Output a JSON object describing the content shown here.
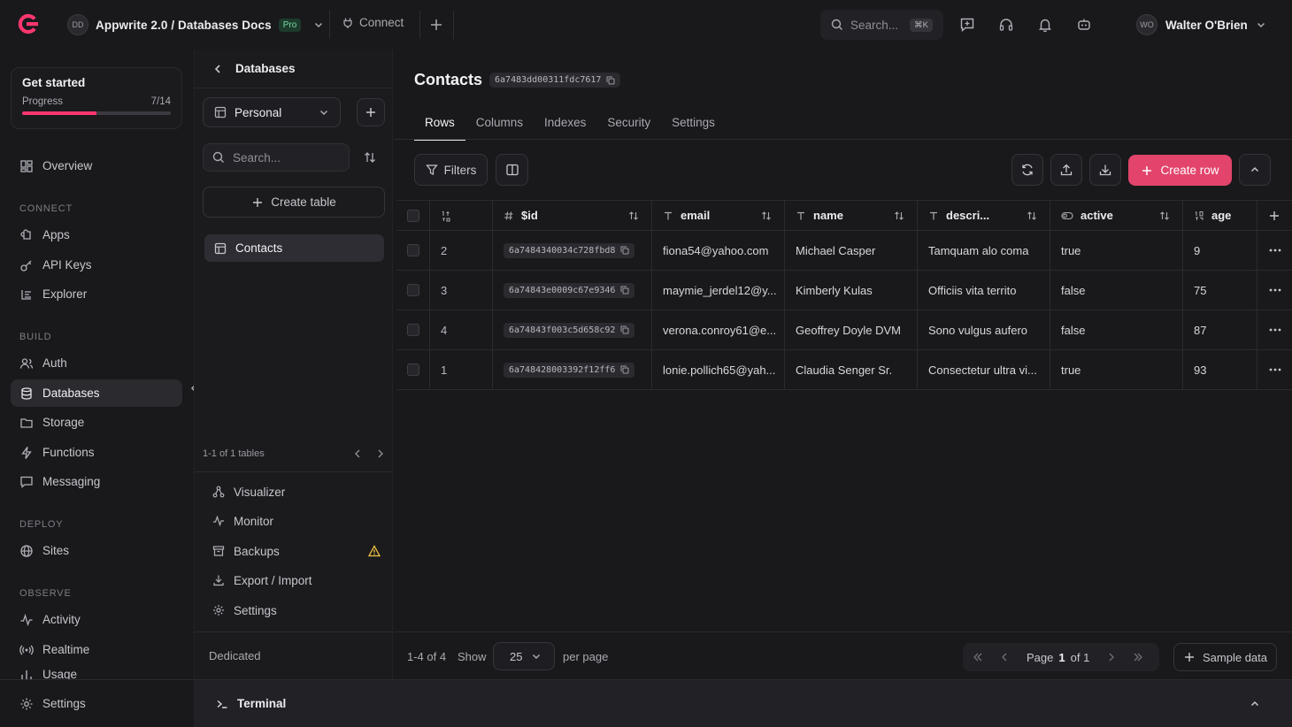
{
  "topbar": {
    "project_avatar": "DD",
    "project_name": "Appwrite 2.0 / Databases Docs",
    "plan_badge": "Pro",
    "connect_label": "Connect",
    "search_placeholder": "Search...",
    "search_shortcut": "⌘K",
    "user_initials": "WO",
    "user_name": "Walter O'Brien"
  },
  "sidebar": {
    "get_started": {
      "title": "Get started",
      "progress_label": "Progress",
      "progress_text": "7/14",
      "progress_fraction": 0.5
    },
    "overview": "Overview",
    "sections": {
      "connect": "CONNECT",
      "build": "BUILD",
      "deploy": "DEPLOY",
      "observe": "OBSERVE"
    },
    "items": {
      "apps": "Apps",
      "api_keys": "API Keys",
      "explorer": "Explorer",
      "auth": "Auth",
      "databases": "Databases",
      "storage": "Storage",
      "functions": "Functions",
      "messaging": "Messaging",
      "sites": "Sites",
      "activity": "Activity",
      "realtime": "Realtime",
      "usage": "Usage",
      "settings": "Settings"
    }
  },
  "db_panel": {
    "back_title": "Databases",
    "selected_database": "Personal",
    "search_placeholder": "Search...",
    "create_table": "Create table",
    "tables": [
      "Contacts"
    ],
    "pager_text": "1-1 of 1 tables",
    "links": {
      "visualizer": "Visualizer",
      "monitor": "Monitor",
      "backups": "Backups",
      "export_import": "Export / Import",
      "settings": "Settings"
    },
    "dedicated": "Dedicated"
  },
  "main": {
    "title": "Contacts",
    "table_id": "6a7483dd00311fdc7617",
    "tabs": [
      "Rows",
      "Columns",
      "Indexes",
      "Security",
      "Settings"
    ],
    "active_tab": "Rows",
    "filters_label": "Filters",
    "create_row_label": "Create row",
    "columns": [
      "$id",
      "email",
      "name",
      "descri...",
      "active",
      "age"
    ],
    "rows": [
      {
        "n": "2",
        "id": "6a7484340034c728fbd8",
        "email": "fiona54@yahoo.com",
        "name": "Michael Casper",
        "description": "Tamquam alo coma",
        "active": "true",
        "age": "9"
      },
      {
        "n": "3",
        "id": "6a74843e0009c67e9346",
        "email": "maymie_jerdel12@y...",
        "name": "Kimberly Kulas",
        "description": "Officiis vita territo",
        "active": "false",
        "age": "75"
      },
      {
        "n": "4",
        "id": "6a74843f003c5d658c92",
        "email": "verona.conroy61@e...",
        "name": "Geoffrey Doyle DVM",
        "description": "Sono vulgus aufero",
        "active": "false",
        "age": "87"
      },
      {
        "n": "1",
        "id": "6a748428003392f12ff6",
        "email": "lonie.pollich65@yah...",
        "name": "Claudia Senger Sr.",
        "description": "Consectetur ultra vi...",
        "active": "true",
        "age": "93"
      }
    ],
    "footer": {
      "count": "1-4 of 4",
      "show": "Show",
      "per_page_value": "25",
      "per_page": "per page",
      "page_label": "Page",
      "page_current": "1",
      "page_of": "of 1",
      "sample_data": "Sample data"
    }
  },
  "terminal": {
    "label": "Terminal"
  },
  "colors": {
    "accent": "#fd366e",
    "create_row": "#e2446c",
    "warning": "#f5c542"
  }
}
